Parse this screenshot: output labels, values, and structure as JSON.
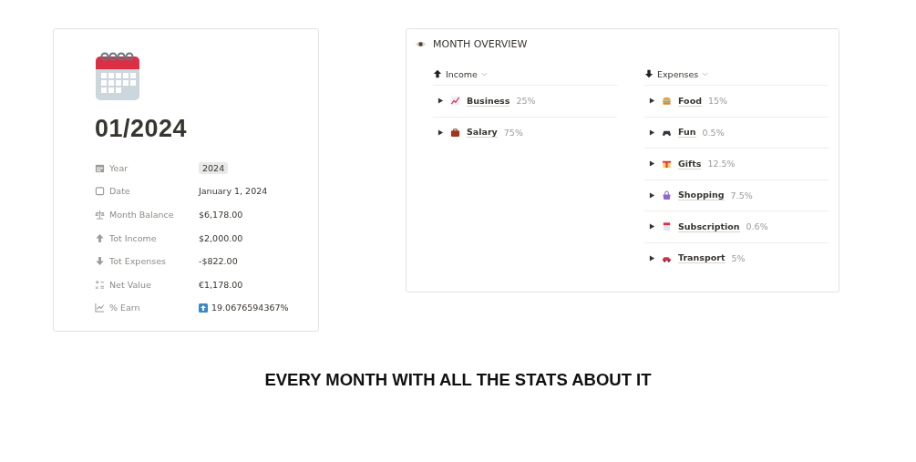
{
  "page": {
    "title": "01/2024",
    "properties": [
      {
        "kind": "tag",
        "label": "Year",
        "value": "2024"
      },
      {
        "kind": "text",
        "label": "Date",
        "value": "January 1, 2024"
      },
      {
        "kind": "text",
        "label": "Month Balance",
        "value": "$6,178.00"
      },
      {
        "kind": "text",
        "label": "Tot Income",
        "value": "$2,000.00"
      },
      {
        "kind": "text",
        "label": "Tot Expenses",
        "value": "-$822.00"
      },
      {
        "kind": "text",
        "label": "Net Value",
        "value": "€1,178.00"
      },
      {
        "kind": "badge",
        "label": "% Earn",
        "value": "19.0676594367%"
      }
    ]
  },
  "overview": {
    "title": "MONTH OVERVIEW",
    "groups": [
      {
        "name": "Income",
        "kind": "up",
        "items": [
          {
            "name": "Business",
            "share": "25%",
            "expanded": false
          },
          {
            "name": "Salary",
            "share": "75%",
            "expanded": false
          }
        ]
      },
      {
        "name": "Expenses",
        "kind": "down",
        "items": [
          {
            "name": "Food",
            "share": "15%",
            "expanded": false
          },
          {
            "name": "Fun",
            "share": "0.5%",
            "expanded": false
          },
          {
            "name": "Gifts",
            "share": "12.5%",
            "expanded": false
          },
          {
            "name": "Shopping",
            "share": "7.5%",
            "expanded": false
          },
          {
            "name": "Subscription",
            "share": "0.6%",
            "expanded": false
          },
          {
            "name": "Transport",
            "share": "5%",
            "expanded": false
          }
        ]
      }
    ]
  },
  "caption": "EVERY MONTH WITH ALL THE STATS ABOUT IT"
}
